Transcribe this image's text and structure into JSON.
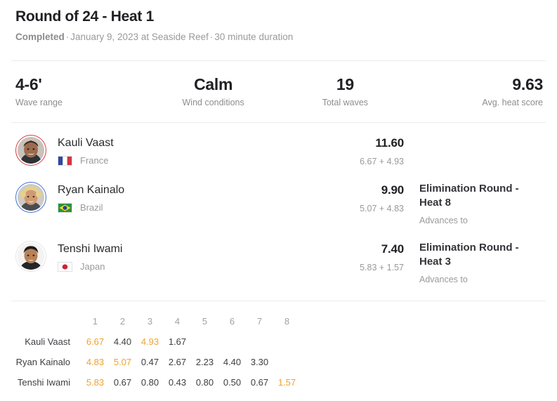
{
  "header": {
    "title": "Round of 24 - Heat 1",
    "status": "Completed",
    "sep1": "·",
    "datetime": "January 9, 2023 at Seaside Reef",
    "sep2": "·",
    "duration": "30 minute duration"
  },
  "stats": [
    {
      "value": "4-6'",
      "label": "Wave range"
    },
    {
      "value": "Calm",
      "label": "Wind conditions"
    },
    {
      "value": "19",
      "label": "Total waves"
    },
    {
      "value": "9.63",
      "label": "Avg. heat score"
    }
  ],
  "athletes": [
    {
      "name": "Kauli Vaast",
      "country": "France",
      "flag": "flag-france",
      "ring": "ring-red",
      "total": "11.60",
      "breakdown": "6.67 + 4.93",
      "advances_to": "",
      "advances_label": ""
    },
    {
      "name": "Ryan Kainalo",
      "country": "Brazil",
      "flag": "flag-brazil",
      "ring": "ring-blue",
      "total": "9.90",
      "breakdown": "5.07 + 4.83",
      "advances_to": "Elimination Round - Heat 8",
      "advances_label": "Advances to"
    },
    {
      "name": "Tenshi Iwami",
      "country": "Japan",
      "flag": "flag-japan",
      "ring": "ring-gray",
      "total": "7.40",
      "breakdown": "5.83 + 1.57",
      "advances_to": "Elimination Round - Heat 3",
      "advances_label": "Advances to"
    }
  ],
  "wave_table": {
    "columns": [
      "1",
      "2",
      "3",
      "4",
      "5",
      "6",
      "7",
      "8"
    ],
    "rows": [
      {
        "name": "Kauli Vaast",
        "scores": [
          "6.67",
          "4.40",
          "4.93",
          "1.67",
          "",
          "",
          "",
          ""
        ],
        "counted": [
          true,
          false,
          true,
          false,
          false,
          false,
          false,
          false
        ]
      },
      {
        "name": "Ryan Kainalo",
        "scores": [
          "4.83",
          "5.07",
          "0.47",
          "2.67",
          "2.23",
          "4.40",
          "3.30",
          ""
        ],
        "counted": [
          true,
          true,
          false,
          false,
          false,
          false,
          false,
          false
        ]
      },
      {
        "name": "Tenshi Iwami",
        "scores": [
          "5.83",
          "0.67",
          "0.80",
          "0.43",
          "0.80",
          "0.50",
          "0.67",
          "1.57"
        ],
        "counted": [
          true,
          false,
          false,
          false,
          false,
          false,
          false,
          true
        ]
      }
    ]
  },
  "colors": {
    "counted_score": "#f0a22e",
    "ring_red": "#d93a3f",
    "ring_blue": "#3c6fd6",
    "text_primary": "#1f2023",
    "text_muted": "#9a9a9e"
  }
}
